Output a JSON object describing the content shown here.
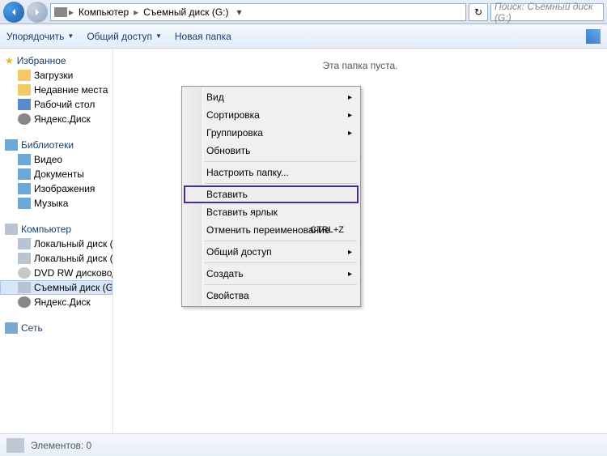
{
  "breadcrumb": {
    "item1": "Компьютер",
    "item2": "Съемный диск (G:)"
  },
  "search": {
    "placeholder": "Поиск: Съемный диск (G:)"
  },
  "toolbar": {
    "organize": "Упорядочить",
    "share": "Общий доступ",
    "newfolder": "Новая папка"
  },
  "sidebar": {
    "fav": {
      "header": "Избранное",
      "items": [
        "Загрузки",
        "Недавние места",
        "Рабочий стол",
        "Яндекс.Диск"
      ]
    },
    "lib": {
      "header": "Библиотеки",
      "items": [
        "Видео",
        "Документы",
        "Изображения",
        "Музыка"
      ]
    },
    "comp": {
      "header": "Компьютер",
      "items": [
        "Локальный диск (C:)",
        "Локальный диск (D:)",
        "DVD RW дисковод (",
        "Съемный диск (G:)",
        "Яндекс.Диск"
      ]
    },
    "net": {
      "header": "Сеть"
    }
  },
  "content": {
    "empty": "Эта папка пуста."
  },
  "context_menu": {
    "view": "Вид",
    "sort": "Сортировка",
    "group": "Группировка",
    "refresh": "Обновить",
    "customize": "Настроить папку...",
    "paste": "Вставить",
    "paste_shortcut": "Вставить ярлык",
    "undo_rename": "Отменить переименование",
    "undo_shortcut": "CTRL+Z",
    "share": "Общий доступ",
    "new": "Создать",
    "properties": "Свойства"
  },
  "status": {
    "elements": "Элементов: 0"
  }
}
